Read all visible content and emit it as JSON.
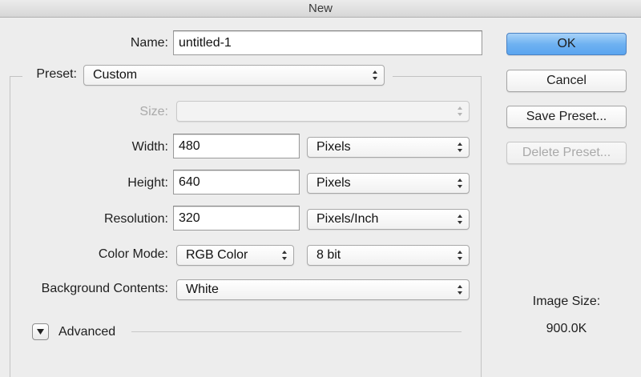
{
  "window": {
    "title": "New"
  },
  "form": {
    "name_label": "Name:",
    "name_value": "untitled-1",
    "preset_label": "Preset:",
    "preset_value": "Custom",
    "size_label": "Size:",
    "size_value": "",
    "width_label": "Width:",
    "width_value": "480",
    "width_unit": "Pixels",
    "height_label": "Height:",
    "height_value": "640",
    "height_unit": "Pixels",
    "resolution_label": "Resolution:",
    "resolution_value": "320",
    "resolution_unit": "Pixels/Inch",
    "color_mode_label": "Color Mode:",
    "color_mode_value": "RGB Color",
    "bit_depth_value": "8 bit",
    "background_label": "Background Contents:",
    "background_value": "White",
    "advanced_label": "Advanced"
  },
  "buttons": {
    "ok": "OK",
    "cancel": "Cancel",
    "save_preset": "Save Preset...",
    "delete_preset": "Delete Preset..."
  },
  "info": {
    "image_size_label": "Image Size:",
    "image_size_value": "900.0K"
  },
  "colors": {
    "default_button": "#6fb2f1",
    "dialog_background": "#ededed",
    "disabled_text": "#a9a9a9"
  },
  "icons": {
    "updown": "updown-arrows-icon",
    "advanced": "triangle-down-icon"
  }
}
